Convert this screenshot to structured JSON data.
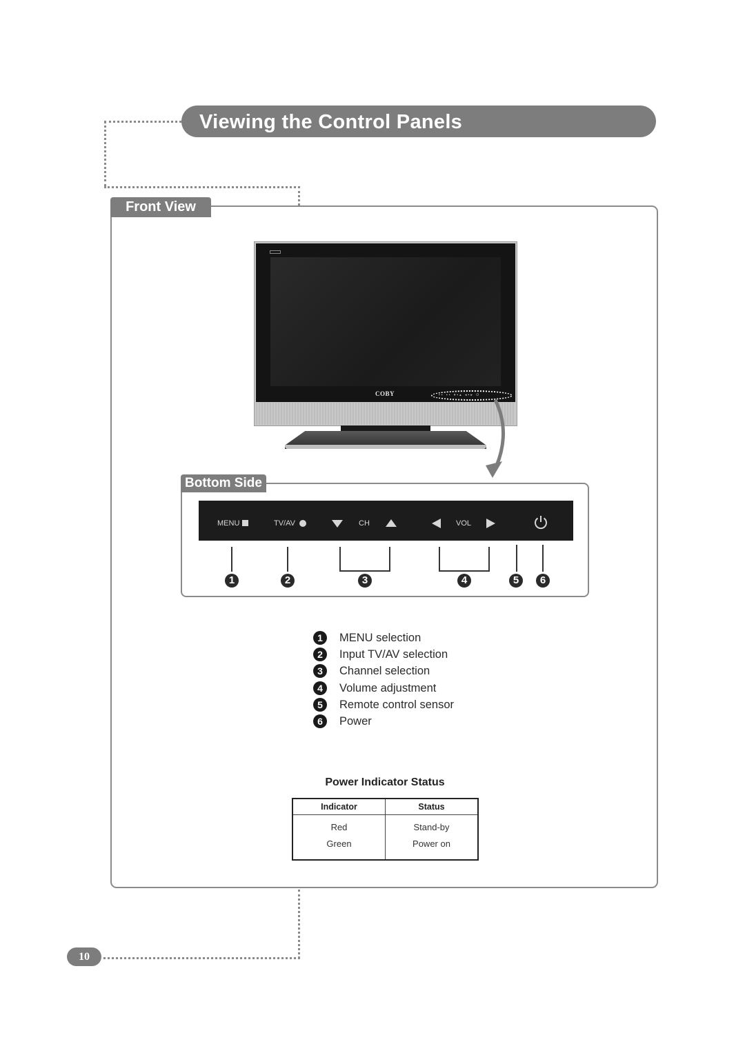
{
  "page": {
    "title": "Viewing the Control Panels",
    "page_number": "10"
  },
  "front_view": {
    "tab_label": "Front View",
    "tv_brand": "COBY"
  },
  "bottom_side": {
    "tab_label": "Bottom Side",
    "panel_controls": [
      {
        "label": "MENU",
        "icon": "square-icon"
      },
      {
        "label": "TV/AV",
        "icon": "circle-icon"
      },
      {
        "label": "CH",
        "icon_left": "triangle-down-icon",
        "icon_right": "triangle-up-icon"
      },
      {
        "label": "VOL",
        "icon_left": "triangle-left-icon",
        "icon_right": "triangle-right-icon"
      },
      {
        "label": "",
        "icon": "power-icon"
      }
    ],
    "callout_numbers": [
      "1",
      "2",
      "3",
      "4",
      "5",
      "6"
    ]
  },
  "legend": [
    {
      "num": "1",
      "text": "MENU selection"
    },
    {
      "num": "2",
      "text": "Input TV/AV selection"
    },
    {
      "num": "3",
      "text": "Channel selection"
    },
    {
      "num": "4",
      "text": "Volume adjustment"
    },
    {
      "num": "5",
      "text": "Remote control sensor"
    },
    {
      "num": "6",
      "text": "Power"
    }
  ],
  "power_indicator": {
    "title": "Power Indicator Status",
    "headers": [
      "Indicator",
      "Status"
    ],
    "rows": [
      [
        "Red",
        "Stand-by"
      ],
      [
        "Green",
        "Power on"
      ]
    ]
  },
  "colors": {
    "banner_gray": "#7d7d7d",
    "frame_gray": "#8a8a8a",
    "panel_black": "#1c1c1c"
  }
}
